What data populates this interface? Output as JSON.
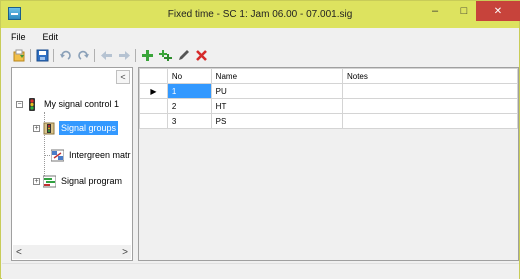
{
  "window": {
    "title": "Fixed time - SC 1: Jam 06.00 - 07.001.sig",
    "minimize": "–",
    "maximize": "□",
    "close": "✕"
  },
  "menu": {
    "file": "File",
    "edit": "Edit"
  },
  "toolbar": {
    "icons": [
      "open-icon",
      "save-icon",
      "undo-icon",
      "redo-icon",
      "move-left-icon",
      "move-right-icon",
      "add-icon",
      "duplicate-icon",
      "edit-icon",
      "delete-icon"
    ]
  },
  "sidebar": {
    "collapse": "<",
    "scroll_left": "<",
    "scroll_right": ">",
    "tree": {
      "root": "My signal control 1",
      "items": [
        "Signal groups",
        "Intergreen matr",
        "Signal program"
      ]
    }
  },
  "grid": {
    "columns": [
      "No",
      "Name",
      "Notes"
    ],
    "row_indicator": "▶",
    "rows": [
      {
        "no": "1",
        "name": "PU",
        "notes": ""
      },
      {
        "no": "2",
        "name": "HT",
        "notes": ""
      },
      {
        "no": "3",
        "name": "PS",
        "notes": ""
      }
    ]
  },
  "colors": {
    "titlebar": "#dde35f",
    "selection": "#3399ff",
    "close_button": "#c7433b"
  }
}
